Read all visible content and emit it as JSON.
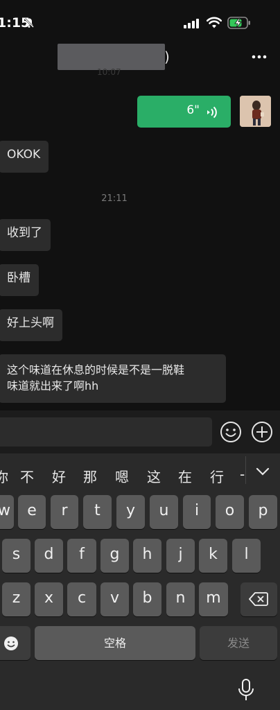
{
  "status_bar": {
    "time": "1:15"
  },
  "header": {
    "paren": ")",
    "subtitle": "10:07"
  },
  "messages": {
    "voice": {
      "duration": "6\""
    },
    "m1": "OKOK",
    "ts2": "21:11",
    "m2": "收到了",
    "m3": "卧槽",
    "m4": "好上头啊",
    "m5_line1": "这个味道在休息的时候是不是一脱鞋",
    "m5_line2": "味道就出来了啊hh"
  },
  "keyboard": {
    "candidates": [
      "你",
      "不",
      "好",
      "那",
      "嗯",
      "这",
      "在",
      "行",
      "-"
    ],
    "row1": [
      "w",
      "e",
      "r",
      "t",
      "y",
      "u",
      "i",
      "o",
      "p"
    ],
    "row2": [
      "s",
      "d",
      "f",
      "g",
      "h",
      "j",
      "k",
      "l"
    ],
    "row3": [
      "z",
      "x",
      "c",
      "v",
      "b",
      "n",
      "m"
    ],
    "space_label": "空格",
    "send_label": "发送"
  }
}
